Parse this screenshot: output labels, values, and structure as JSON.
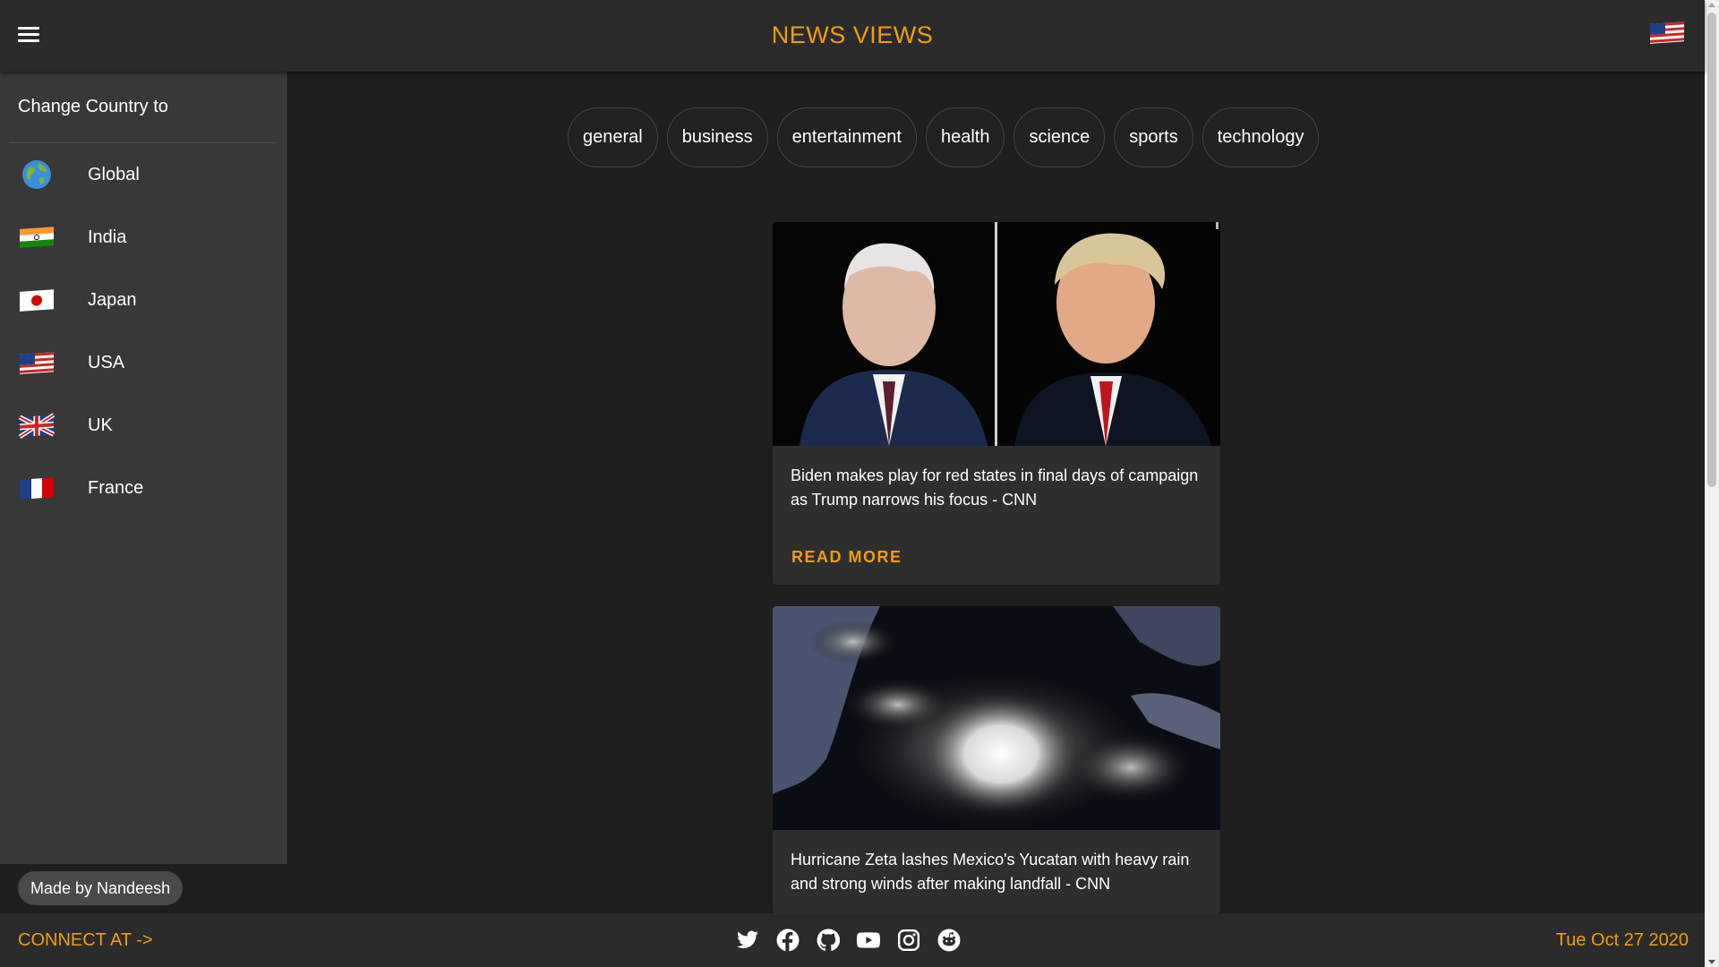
{
  "header": {
    "brand": "NEWS VIEWS",
    "flag_icon": "usa-flag-icon",
    "menu_icon": "hamburger-menu-icon"
  },
  "sidebar": {
    "title": "Change Country to",
    "items": [
      {
        "label": "Global",
        "icon": "globe-icon"
      },
      {
        "label": "India",
        "icon": "india-flag-icon"
      },
      {
        "label": "Japan",
        "icon": "japan-flag-icon"
      },
      {
        "label": "USA",
        "icon": "usa-flag-icon"
      },
      {
        "label": "UK",
        "icon": "uk-flag-icon"
      },
      {
        "label": "France",
        "icon": "france-flag-icon"
      }
    ],
    "made_by": "Made by Nandeesh"
  },
  "categories": [
    "general",
    "business",
    "entertainment",
    "health",
    "science",
    "sports",
    "technology"
  ],
  "articles": [
    {
      "title": "Biden makes play for red states in final days of campaign as Trump narrows his focus - CNN",
      "action": "READ MORE"
    },
    {
      "title": "Hurricane Zeta lashes Mexico's Yucatan with heavy rain and strong winds after making landfall - CNN"
    }
  ],
  "footer": {
    "connect": "CONNECT AT ->",
    "socials": [
      "twitter-icon",
      "facebook-icon",
      "github-icon",
      "youtube-icon",
      "instagram-icon",
      "reddit-icon"
    ],
    "date": "Tue Oct 27 2020"
  },
  "colors": {
    "accent": "#f39c12",
    "background": "#1f1f1f",
    "bar": "#2b2b2b",
    "sidebar": "#383838"
  }
}
